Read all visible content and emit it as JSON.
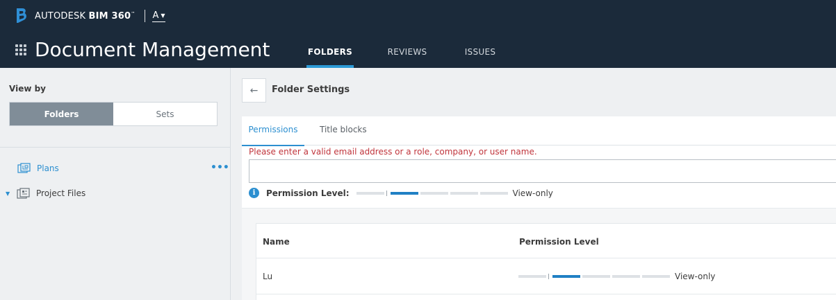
{
  "header": {
    "brand_name": "AUTODESK",
    "brand_product": "BIM 360",
    "account_label": "A",
    "app_title": "Document Management",
    "tabs": [
      {
        "label": "FOLDERS",
        "active": true
      },
      {
        "label": "REVIEWS",
        "active": false
      },
      {
        "label": "ISSUES",
        "active": false
      }
    ],
    "colors": {
      "background": "#1b2a3a",
      "accent": "#2c9ad6"
    }
  },
  "sidebar": {
    "view_by_label": "View by",
    "toggle": {
      "options": [
        "Folders",
        "Sets"
      ],
      "selected": "Folders"
    },
    "tree": [
      {
        "label": "Plans",
        "icon": "plans-icon",
        "selected": true
      },
      {
        "label": "Project Files",
        "icon": "project-files-icon",
        "expanded": true
      }
    ]
  },
  "main": {
    "title": "Folder Settings",
    "tabs": [
      {
        "label": "Permissions",
        "active": true
      },
      {
        "label": "Title blocks",
        "active": false
      }
    ],
    "error_message": "Please enter a valid email address or a role, company, or user name.",
    "input": {
      "value": "",
      "placeholder": ""
    },
    "permission_label": "Permission Level:",
    "permission_value": "View-only",
    "permission_level": {
      "active_segment": 1,
      "total_segments": 5
    },
    "table": {
      "columns": [
        "Name",
        "Permission Level"
      ],
      "rows": [
        {
          "name": "Lu",
          "permission": "View-only",
          "level": 1
        }
      ]
    },
    "colors": {
      "error": "#c0343b",
      "link": "#2c8fd0",
      "level_active": "#2080c4"
    }
  }
}
